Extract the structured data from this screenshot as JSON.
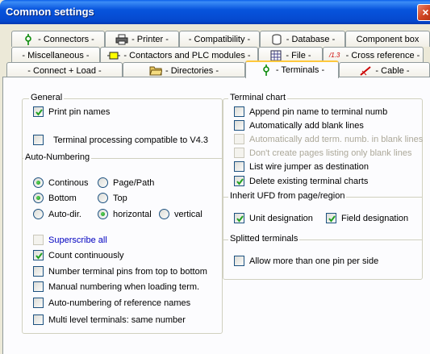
{
  "window": {
    "title": "Common settings",
    "close_glyph": "×"
  },
  "tabs_row1": [
    {
      "label": "- Connectors -",
      "icon": "connector-icon"
    },
    {
      "label": "- Printer -",
      "icon": "printer-icon"
    },
    {
      "label": "- Compatibility -",
      "icon": ""
    },
    {
      "label": "- Database -",
      "icon": "database-icon"
    },
    {
      "label": "Component box",
      "icon": ""
    }
  ],
  "tabs_row2": [
    {
      "label": "- Miscellaneous -",
      "icon": ""
    },
    {
      "label": "- Contactors and PLC modules -",
      "icon": "contactor-icon"
    },
    {
      "label": "- File -",
      "icon": "file-grid-icon"
    },
    {
      "label": "- Cross reference -",
      "icon": "cross-reference-icon",
      "icon_text": "/1.3"
    }
  ],
  "tabs_row3": [
    {
      "label": "- Connect + Load -",
      "icon": ""
    },
    {
      "label": "- Directories -",
      "icon": "folder-icon"
    },
    {
      "label": "- Terminals -",
      "icon": "terminal-icon",
      "active": true
    },
    {
      "label": "- Cable -",
      "icon": "cable-icon"
    }
  ],
  "general": {
    "title": "General",
    "print_pin_names": {
      "label": "Print pin names",
      "checked": true
    },
    "terminal_processing": {
      "label": "Terminal processing compatible to V4.3",
      "checked": false
    }
  },
  "auto_numbering": {
    "title": "Auto-Numbering",
    "continous": {
      "label": "Continous",
      "selected": true
    },
    "page_path": {
      "label": "Page/Path",
      "selected": false
    },
    "bottom": {
      "label": "Bottom",
      "selected": true
    },
    "top": {
      "label": "Top",
      "selected": false
    },
    "auto_dir": {
      "label": "Auto-dir.",
      "selected": false
    },
    "horizontal": {
      "label": "horizontal",
      "selected": true
    },
    "vertical": {
      "label": "vertical",
      "selected": false
    },
    "superscribe_all": {
      "label": "Superscribe all",
      "checked": false
    },
    "count_continuously": {
      "label": "Count continuously",
      "checked": true
    },
    "number_top_bottom": {
      "label": "Number terminal pins from top to bottom",
      "checked": false
    },
    "manual_numbering": {
      "label": "Manual numbering when loading term.",
      "checked": false
    },
    "auto_ref_names": {
      "label": "Auto-numbering of reference names",
      "checked": false
    },
    "multi_level": {
      "label": "Multi level terminals: same number",
      "checked": false
    }
  },
  "terminal_chart": {
    "title": "Terminal chart",
    "append_pin_name": {
      "label": "Append pin name to terminal numb",
      "checked": false
    },
    "add_blank_lines": {
      "label": "Automatically add blank lines",
      "checked": false
    },
    "add_term_numb": {
      "label": "Automatically add term. numb. in blank lines",
      "checked": false,
      "disabled": true
    },
    "dont_create_pages": {
      "label": "Don't create pages listing only blank lines",
      "checked": false,
      "disabled": true
    },
    "list_wire_jumper": {
      "label": "List wire jumper as destination",
      "checked": false
    },
    "delete_existing": {
      "label": "Delete existing terminal charts",
      "checked": true
    }
  },
  "inherit_ufd": {
    "title": "Inherit UFD from page/region",
    "unit_designation": {
      "label": "Unit designation",
      "checked": true
    },
    "field_designation": {
      "label": "Field designation",
      "checked": true
    }
  },
  "splitted_terminals": {
    "title": "Splitted terminals",
    "allow_more_pins": {
      "label": "Allow more than one pin per side",
      "checked": false
    }
  }
}
